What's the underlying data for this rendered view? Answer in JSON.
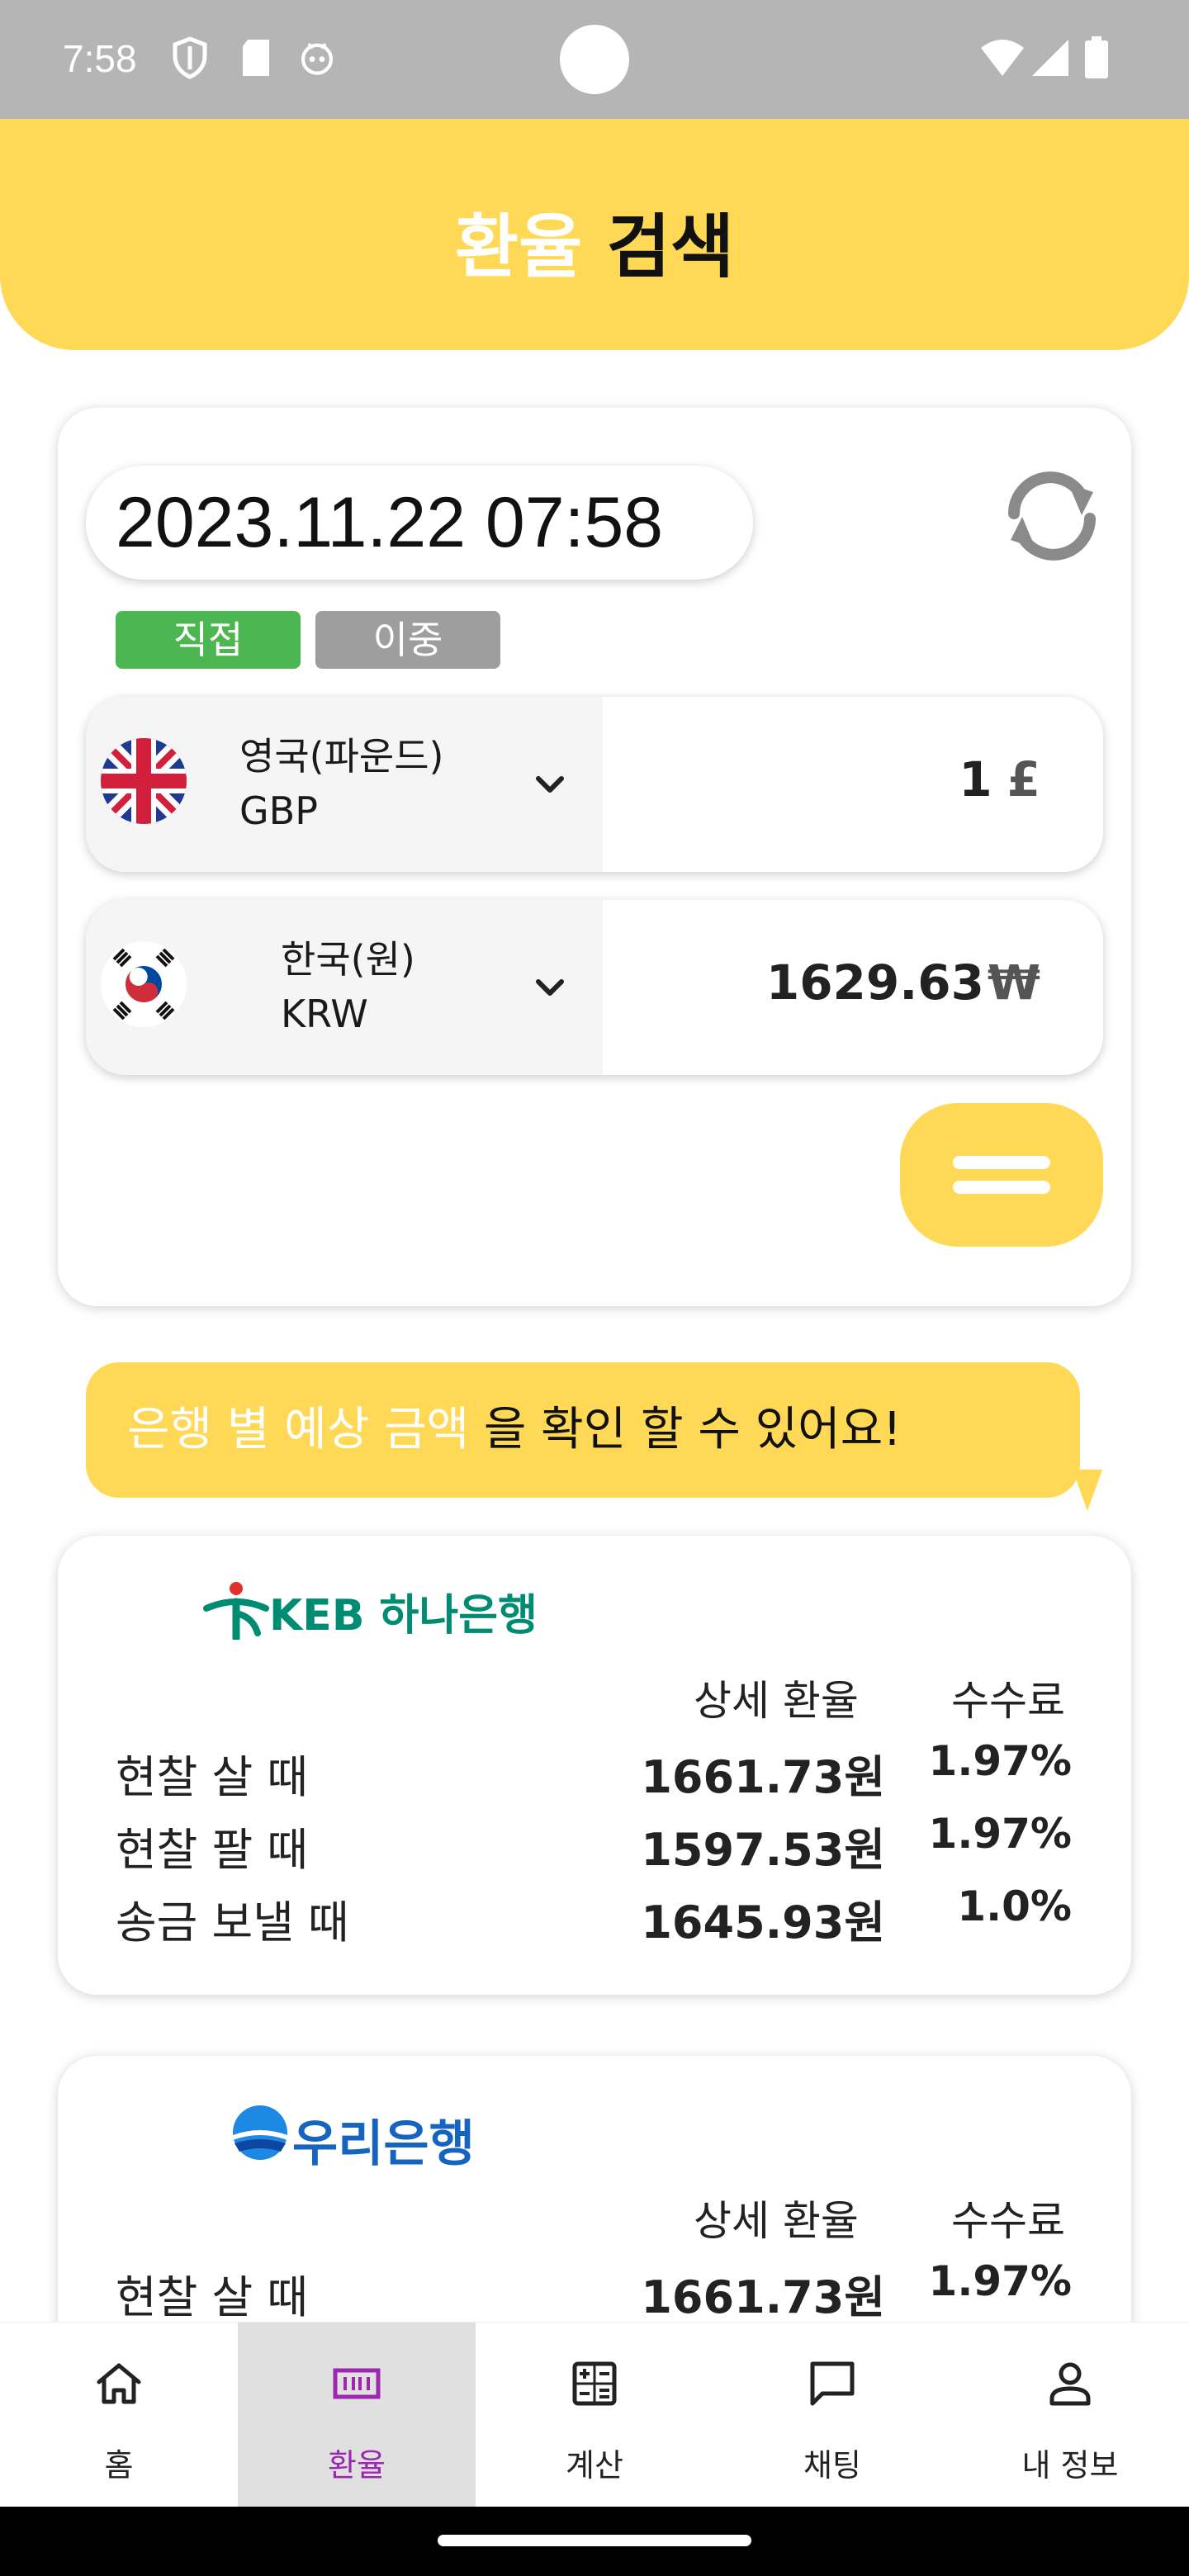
{
  "status_bar": {
    "time": "7:58"
  },
  "header": {
    "title_part1": "환율",
    "title_part2": " 검색"
  },
  "converter": {
    "datetime": "2023.11.22 07:58",
    "tags": {
      "direct": "직접",
      "double": "이중"
    },
    "from": {
      "name": "영국(파운드)",
      "code": "GBP",
      "amount": "1",
      "unit": "£"
    },
    "to": {
      "name": "한국(원)",
      "code": "KRW",
      "amount": "1629.63",
      "unit": "₩"
    }
  },
  "bubble": {
    "highlight": "은행 별 예상 금액",
    "rest": " 을 확인 할 수 있어요!"
  },
  "banks": [
    {
      "name": "KEB 하나은행",
      "headers": {
        "rate": "상세 환율",
        "fee": "수수료"
      },
      "rows": [
        {
          "label": "현찰 살 때",
          "rate": "1661.73원",
          "fee": "1.97%"
        },
        {
          "label": "현찰 팔 때",
          "rate": "1597.53원",
          "fee": "1.97%"
        },
        {
          "label": "송금 보낼 때",
          "rate": "1645.93원",
          "fee": "1.0%"
        }
      ]
    },
    {
      "name": "우리은행",
      "headers": {
        "rate": "상세 환율",
        "fee": "수수료"
      },
      "rows": [
        {
          "label": "현찰 살 때",
          "rate": "1661.73원",
          "fee": "1.97%"
        }
      ]
    }
  ],
  "nav": [
    {
      "label": "홈",
      "icon": "home-icon"
    },
    {
      "label": "환율",
      "icon": "exchange-icon"
    },
    {
      "label": "계산",
      "icon": "calculator-icon"
    },
    {
      "label": "채팅",
      "icon": "chat-icon"
    },
    {
      "label": "내 정보",
      "icon": "profile-icon"
    }
  ],
  "colors": {
    "accent": "#ffd955",
    "direct_tag": "#4cb750",
    "double_tag": "#9e9e9e",
    "nav_active": "#9c27b0"
  }
}
